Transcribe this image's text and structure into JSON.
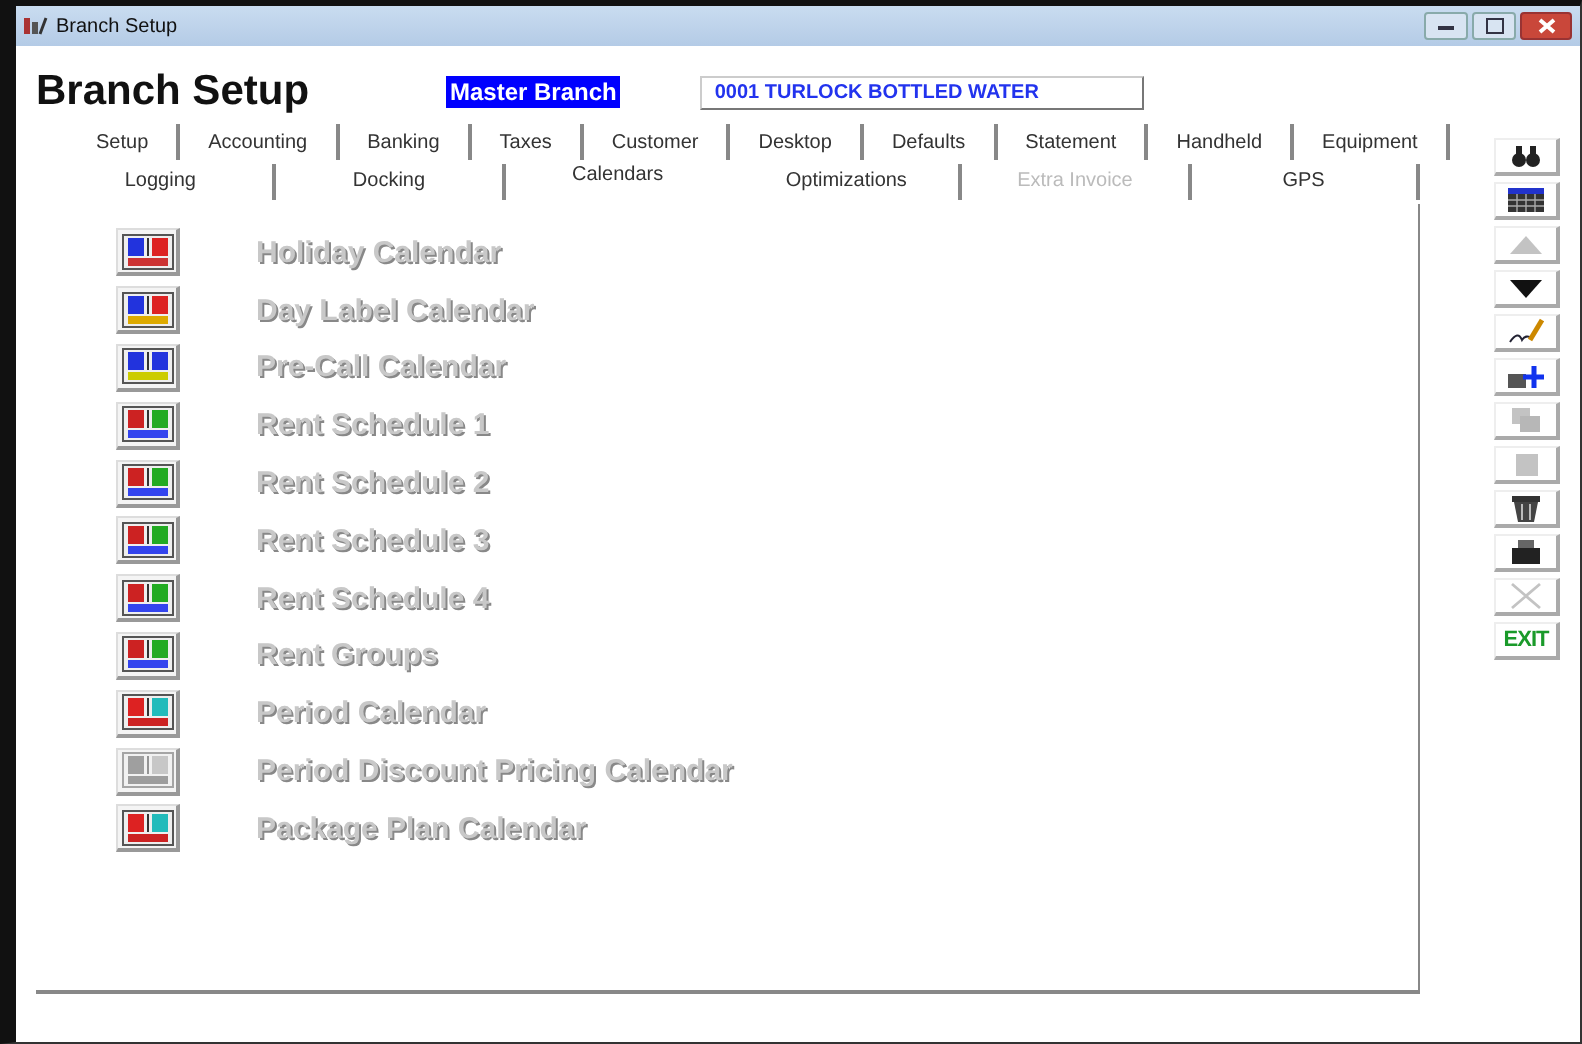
{
  "window": {
    "title": "Branch Setup"
  },
  "heading": "Branch Setup",
  "branch_label": "Master Branch",
  "branch_field": "0001  TURLOCK BOTTLED WATER",
  "tab_rows": [
    [
      {
        "label": "Setup",
        "selected": false,
        "disabled": false
      },
      {
        "label": "Accounting",
        "selected": false,
        "disabled": false
      },
      {
        "label": "Banking",
        "selected": false,
        "disabled": false
      },
      {
        "label": "Taxes",
        "selected": false,
        "disabled": false
      },
      {
        "label": "Customer",
        "selected": false,
        "disabled": false
      },
      {
        "label": "Desktop",
        "selected": false,
        "disabled": false
      },
      {
        "label": "Defaults",
        "selected": false,
        "disabled": false
      },
      {
        "label": "Statement",
        "selected": false,
        "disabled": false
      },
      {
        "label": "Handheld",
        "selected": false,
        "disabled": false
      },
      {
        "label": "Equipment",
        "selected": false,
        "disabled": false
      }
    ],
    [
      {
        "label": "Logging",
        "selected": false,
        "disabled": false
      },
      {
        "label": "Docking",
        "selected": false,
        "disabled": false
      },
      {
        "label": "Calendars",
        "selected": true,
        "disabled": false
      },
      {
        "label": "Optimizations",
        "selected": false,
        "disabled": false
      },
      {
        "label": "Extra Invoice",
        "selected": false,
        "disabled": true
      },
      {
        "label": "GPS",
        "selected": false,
        "disabled": false
      }
    ]
  ],
  "calendars": [
    {
      "label": "Holiday Calendar",
      "kind": "holiday",
      "disabled": false
    },
    {
      "label": "Day Label Calendar",
      "kind": "daylabel",
      "disabled": false
    },
    {
      "label": "Pre-Call Calendar",
      "kind": "precall",
      "disabled": false
    },
    {
      "label": "Rent Schedule 1",
      "kind": "rent",
      "disabled": false
    },
    {
      "label": "Rent Schedule 2",
      "kind": "rent",
      "disabled": false
    },
    {
      "label": "Rent Schedule 3",
      "kind": "rent",
      "disabled": false
    },
    {
      "label": "Rent Schedule 4",
      "kind": "rent",
      "disabled": false
    },
    {
      "label": "Rent Groups",
      "kind": "rent",
      "disabled": false
    },
    {
      "label": "Period Calendar",
      "kind": "period",
      "disabled": false
    },
    {
      "label": "Period Discount Pricing Calendar",
      "kind": "period",
      "disabled": true
    },
    {
      "label": "Package Plan Calendar",
      "kind": "period",
      "disabled": false
    }
  ],
  "toolbar": [
    {
      "kind": "binoculars",
      "disabled": false
    },
    {
      "kind": "grid",
      "disabled": false
    },
    {
      "kind": "up",
      "disabled": true
    },
    {
      "kind": "down",
      "disabled": false
    },
    {
      "kind": "sign",
      "disabled": false
    },
    {
      "kind": "add",
      "disabled": false
    },
    {
      "kind": "copy",
      "disabled": true
    },
    {
      "kind": "square",
      "disabled": true
    },
    {
      "kind": "trash",
      "disabled": false
    },
    {
      "kind": "print",
      "disabled": false
    },
    {
      "kind": "cross",
      "disabled": true
    },
    {
      "kind": "exit",
      "disabled": false,
      "label": "EXIT"
    }
  ]
}
